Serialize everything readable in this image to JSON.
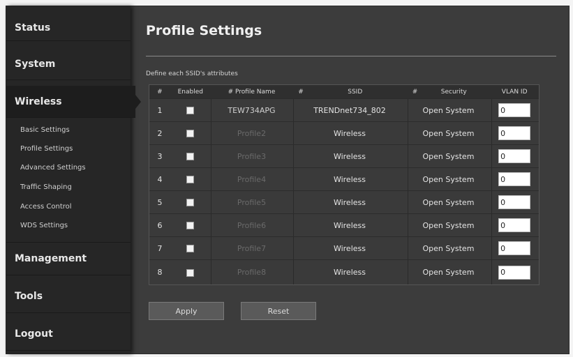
{
  "sidebar": {
    "status": "Status",
    "system": "System",
    "wireless": "Wireless",
    "sub": [
      "Basic Settings",
      "Profile Settings",
      "Advanced Settings",
      "Traffic Shaping",
      "Access Control",
      "WDS Settings"
    ],
    "management": "Management",
    "tools": "Tools",
    "logout": "Logout"
  },
  "main": {
    "title": "Profile Settings",
    "caption": "Define each SSID's attributes",
    "headers": [
      "#",
      "Enabled",
      "# Profile Name",
      "#",
      "SSID",
      "#",
      "Security",
      "VLAN ID"
    ],
    "rows": [
      {
        "id": "1",
        "profile": "TEW734APG",
        "ssid": "TRENDnet734_802",
        "security": "Open System",
        "vlan": "0"
      },
      {
        "id": "2",
        "profile": "Profile2",
        "ssid": "Wireless",
        "security": "Open System",
        "vlan": "0"
      },
      {
        "id": "3",
        "profile": "Profile3",
        "ssid": "Wireless",
        "security": "Open System",
        "vlan": "0"
      },
      {
        "id": "4",
        "profile": "Profile4",
        "ssid": "Wireless",
        "security": "Open System",
        "vlan": "0"
      },
      {
        "id": "5",
        "profile": "Profile5",
        "ssid": "Wireless",
        "security": "Open System",
        "vlan": "0"
      },
      {
        "id": "6",
        "profile": "Profile6",
        "ssid": "Wireless",
        "security": "Open System",
        "vlan": "0"
      },
      {
        "id": "7",
        "profile": "Profile7",
        "ssid": "Wireless",
        "security": "Open System",
        "vlan": "0"
      },
      {
        "id": "8",
        "profile": "Profile8",
        "ssid": "Wireless",
        "security": "Open System",
        "vlan": "0"
      }
    ],
    "apply": "Apply",
    "reset": "Reset"
  }
}
